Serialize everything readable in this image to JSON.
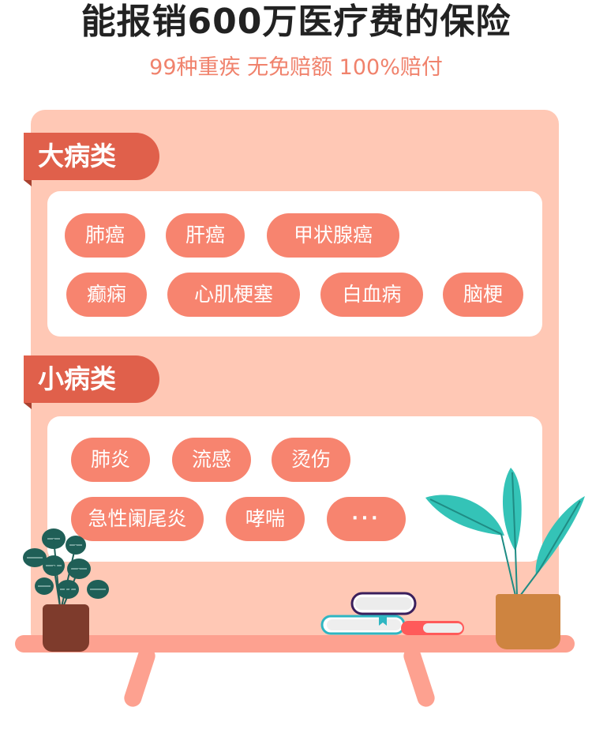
{
  "header": {
    "title": "能报销600万医疗费的保险",
    "subtitle": "99种重疾 无免赔额 100%赔付"
  },
  "sections": [
    {
      "label": "大病类",
      "tags": [
        "肺癌",
        "肝癌",
        "甲状腺癌",
        "癫痫",
        "心肌梗塞",
        "白血病",
        "脑梗"
      ]
    },
    {
      "label": "小病类",
      "tags": [
        "肺炎",
        "流感",
        "烫伤",
        "急性阑尾炎",
        "哮喘",
        "···"
      ]
    }
  ],
  "colors": {
    "title": "#222222",
    "subtitle": "#f0826c",
    "board": "#ffc8b5",
    "ribbon": "#e0604b",
    "tag": "#f7846f",
    "table": "#fda190"
  },
  "illustration": {
    "left_icon": "potted-plant-icon",
    "right_icon": "potted-palm-icon",
    "books_icon": "books-icon"
  }
}
